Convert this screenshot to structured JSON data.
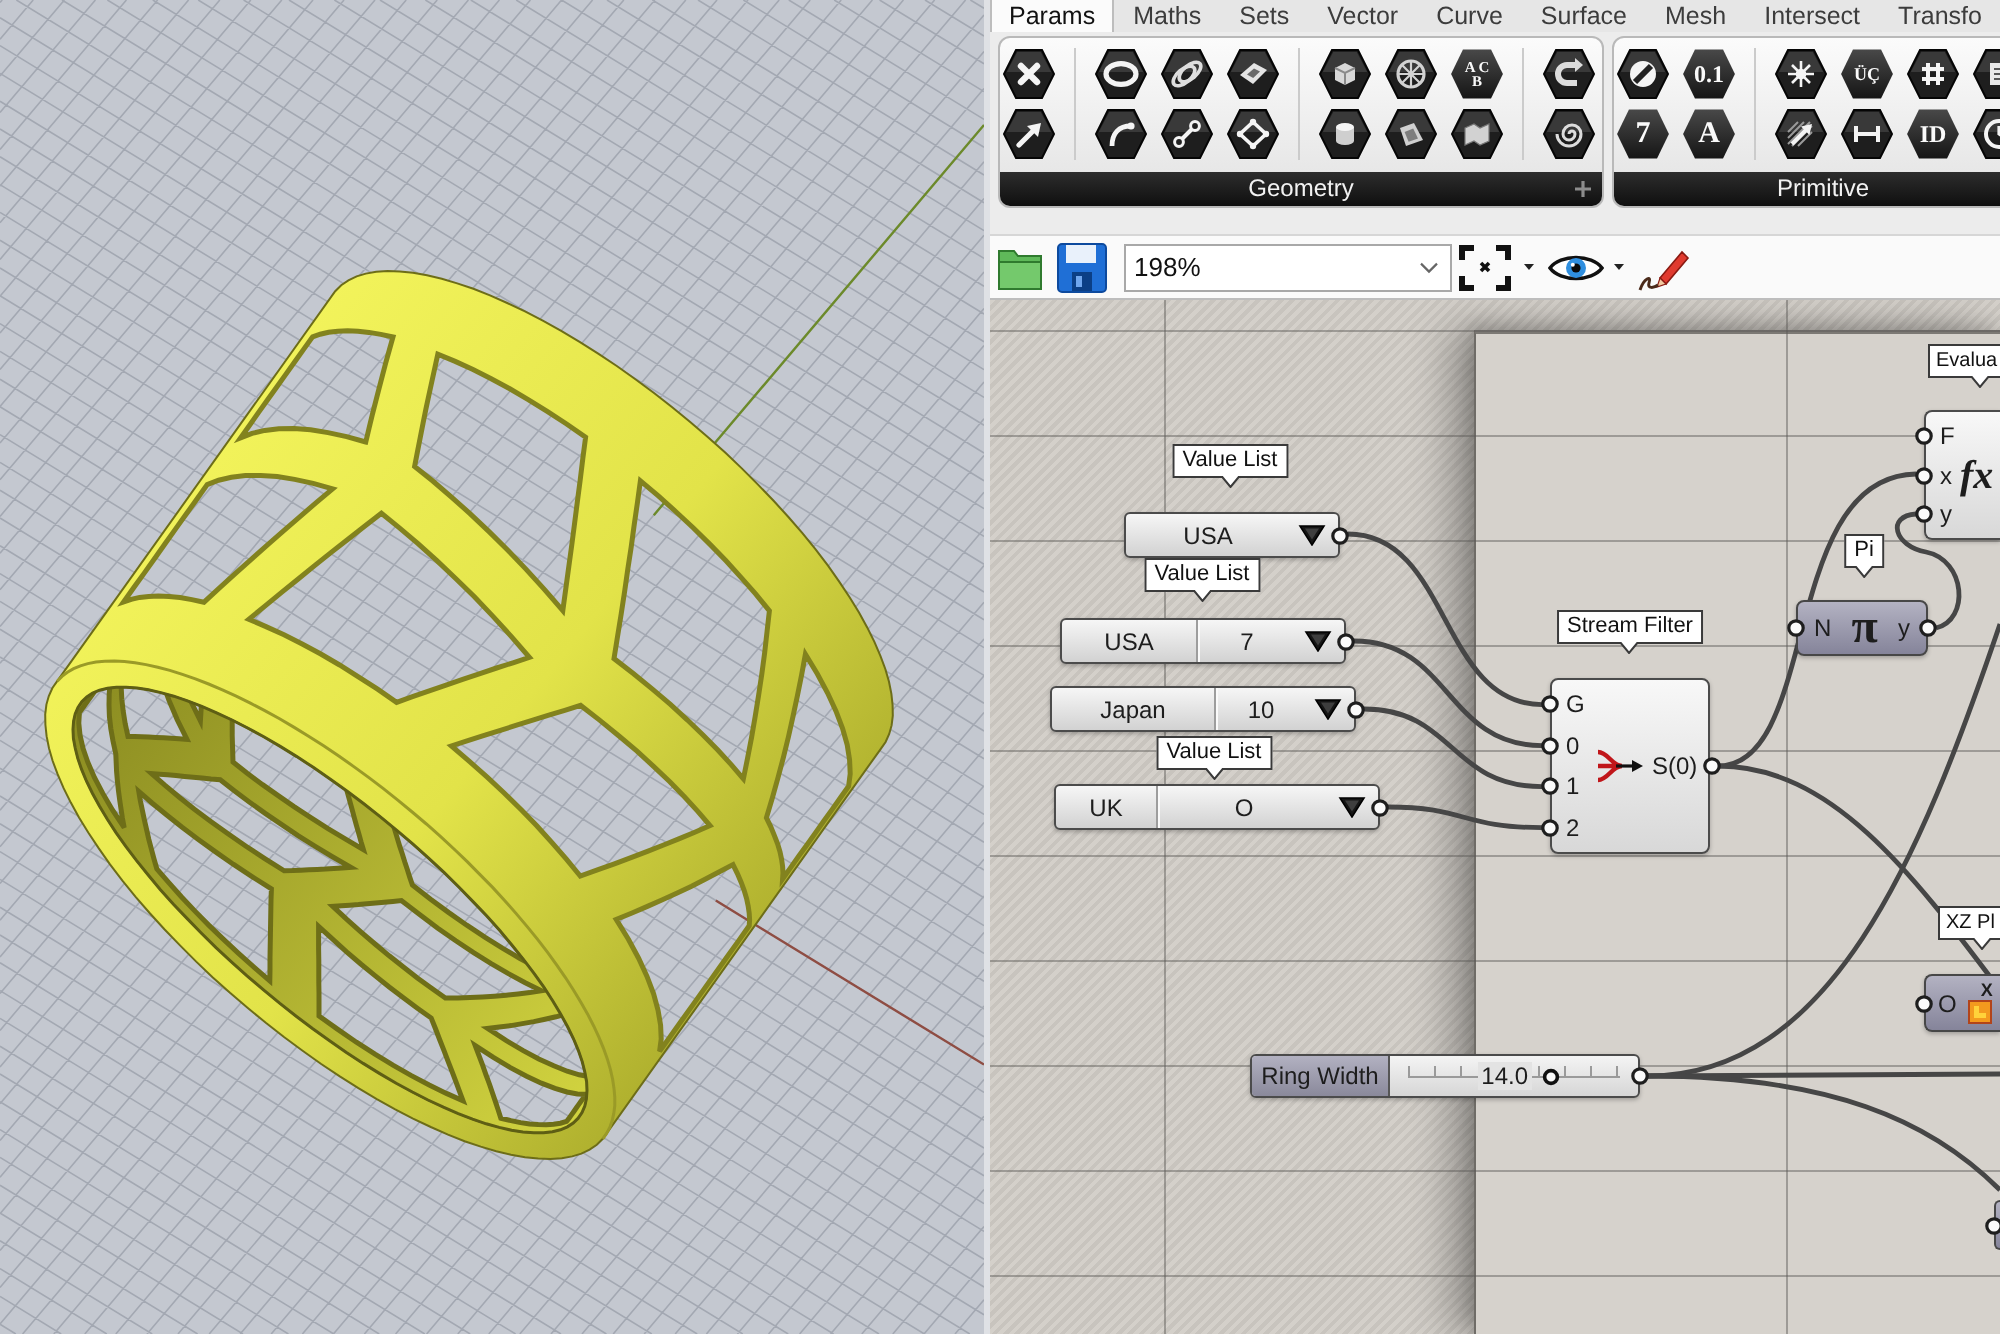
{
  "tabs": [
    {
      "label": "Params",
      "selected": true
    },
    {
      "label": "Maths",
      "selected": false
    },
    {
      "label": "Sets",
      "selected": false
    },
    {
      "label": "Vector",
      "selected": false
    },
    {
      "label": "Curve",
      "selected": false
    },
    {
      "label": "Surface",
      "selected": false
    },
    {
      "label": "Mesh",
      "selected": false
    },
    {
      "label": "Intersect",
      "selected": false
    },
    {
      "label": "Transfo",
      "selected": false
    }
  ],
  "ribbon": [
    {
      "title": "Geometry",
      "button_labels": [
        "A C",
        "B"
      ]
    },
    {
      "title": "Primitive",
      "button_labels": [
        "0.1",
        "ÜÇ",
        "7",
        "A",
        "ID"
      ]
    }
  ],
  "toolbar": {
    "zoom": "198%"
  },
  "canvas": {
    "value_lists": [
      {
        "tag": "Value List",
        "cells": [
          "USA"
        ]
      },
      {
        "tag": "Value List",
        "cells": [
          "USA",
          "7"
        ]
      },
      {
        "cells": [
          "Japan",
          "10"
        ]
      },
      {
        "tag": "Value List",
        "cells": [
          "UK",
          "O"
        ]
      }
    ],
    "stream_filter": {
      "tag": "Stream Filter",
      "inputs": [
        "G",
        "0",
        "1",
        "2"
      ],
      "output": "S(0)"
    },
    "pi": {
      "tag": "Pi",
      "input": "N",
      "symbol": "π",
      "output": "y"
    },
    "evaluate": {
      "tag": "Evalua",
      "inputs": [
        "F",
        "x",
        "y"
      ],
      "symbol": "fx"
    },
    "xz_plane": {
      "tag": "XZ Pl",
      "title": "X",
      "input": "O"
    },
    "slider": {
      "label": "Ring Width",
      "value": "14.0",
      "level": 0.67
    }
  }
}
